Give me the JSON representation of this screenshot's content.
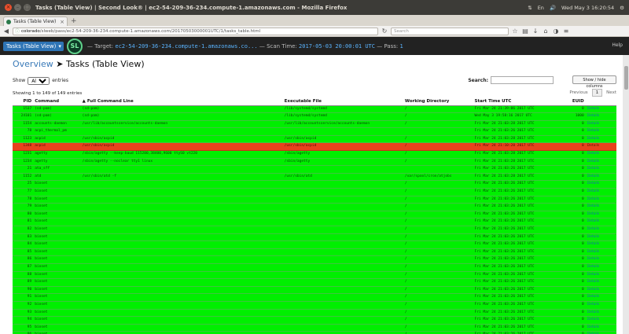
{
  "window": {
    "title": "Tasks (Table View) | Second Look® | ec2-54-209-36-234.compute-1.amazonaws.com - Mozilla Firefox",
    "tray": [
      "⇅",
      "En",
      "🔊",
      "Wed May 3 16:20:54",
      "⚙"
    ]
  },
  "browser": {
    "tab_label": "Tasks (Table View)",
    "url_host": "colorado",
    "url_rest": "/slweb/pass/ec2-54-209-36-234.compute-1.amazonaws.com/20170503000001UTC/1/tasks_table.html",
    "search_placeholder": "Search"
  },
  "header": {
    "dropdown_label": "Tasks (Table View)",
    "logo_text": "SL",
    "target_label": "— Target:",
    "target_value": "ec2-54-209-36-234.compute-1.amazonaws.co...",
    "scan_label": "— Scan Time:",
    "scan_value": "2017-05-03 20:00:01 UTC",
    "pass_label": "— Pass:",
    "pass_value": "1",
    "help": "Help"
  },
  "breadcrumb": {
    "overview": "Overview",
    "sep": "➤",
    "page": "Tasks (Table View)"
  },
  "controls": {
    "show_label": "Show",
    "show_value": "All",
    "entries_label": "entries",
    "search_label": "Search:",
    "show_hide": "Show / hide columns"
  },
  "info": {
    "text": "Showing 1 to 149 of 149 entries",
    "previous": "Previous",
    "page": "1",
    "next": "Next"
  },
  "columns": [
    "PID",
    "Command",
    "Full Command Line",
    "Executable File",
    "Working Directory",
    "Start Time UTC",
    "EUID",
    ""
  ],
  "rows": [
    {
      "status": "ok",
      "pid": "1537",
      "cmd": "(sd-pam)",
      "full": "(sd-pam)",
      "exe": "/lib/systemd/systemd",
      "wd": "/",
      "start": "Fri Mar 24 21:39:06 2017 UTC",
      "euid": "0",
      "det": "Details"
    },
    {
      "status": "ok",
      "pid": "24101",
      "cmd": "(sd-pam)",
      "full": "(sd-pam)",
      "exe": "/lib/systemd/systemd",
      "wd": "/",
      "start": "Wed May 3 19:58:16 2017 UTC",
      "euid": "1000",
      "det": "Details"
    },
    {
      "status": "ok",
      "pid": "1154",
      "cmd": "accounts-daemon",
      "full": "/usr/lib/accountsservice/accounts-daemon",
      "exe": "/usr/lib/accountsservice/accounts-daemon",
      "wd": "/",
      "start": "Fri Mar 24 21:03:28 2017 UTC",
      "euid": "0",
      "det": "Details"
    },
    {
      "status": "ok",
      "pid": "78",
      "cmd": "acpi_thermal_pm",
      "full": "",
      "exe": "",
      "wd": "",
      "start": "Fri Mar 24 21:03:26 2017 UTC",
      "euid": "0",
      "det": "Details"
    },
    {
      "status": "ok",
      "pid": "1123",
      "cmd": "acpid",
      "full": "/usr/sbin/acpid",
      "exe": "/usr/sbin/acpid",
      "wd": "/",
      "start": "Fri Mar 24 21:03:28 2017 UTC",
      "euid": "0",
      "det": "Details"
    },
    {
      "status": "bad",
      "pid": "1348",
      "cmd": "acpid",
      "full": "/usr/sbin/acpid",
      "exe": "/usr/sbin/acpid",
      "wd": "/",
      "start": "Fri Mar 24 21:10:20 2017 UTC",
      "euid": "0",
      "det": "Details"
    },
    {
      "status": "ok",
      "pid": "1231",
      "cmd": "agetty",
      "full": "/sbin/agetty --keep-baud 115200,38400,9600 ttyS0 vt220",
      "exe": "/sbin/agetty",
      "wd": "/",
      "start": "Fri Mar 24 21:03:28 2017 UTC",
      "euid": "0",
      "det": "Details"
    },
    {
      "status": "ok",
      "pid": "1234",
      "cmd": "agetty",
      "full": "/sbin/agetty --noclear tty1 linux",
      "exe": "/sbin/agetty",
      "wd": "/",
      "start": "Fri Mar 24 21:03:28 2017 UTC",
      "euid": "0",
      "det": "Details"
    },
    {
      "status": "ok",
      "pid": "21",
      "cmd": "ata_sff",
      "full": "",
      "exe": "",
      "wd": "",
      "start": "Fri Mar 24 21:03:26 2017 UTC",
      "euid": "0",
      "det": "Details"
    },
    {
      "status": "ok",
      "pid": "1152",
      "cmd": "atd",
      "full": "/usr/sbin/atd -f",
      "exe": "/usr/sbin/atd",
      "wd": "/var/spool/cron/atjobs",
      "start": "Fri Mar 24 21:03:28 2017 UTC",
      "euid": "0",
      "det": "Details"
    },
    {
      "status": "ok",
      "pid": "25",
      "cmd": "bioset",
      "full": "",
      "exe": "",
      "wd": "/",
      "start": "Fri Mar 24 21:03:26 2017 UTC",
      "euid": "0",
      "det": "Details"
    },
    {
      "status": "ok",
      "pid": "77",
      "cmd": "bioset",
      "full": "",
      "exe": "",
      "wd": "/",
      "start": "Fri Mar 24 21:03:26 2017 UTC",
      "euid": "0",
      "det": "Details"
    },
    {
      "status": "ok",
      "pid": "78",
      "cmd": "bioset",
      "full": "",
      "exe": "",
      "wd": "/",
      "start": "Fri Mar 24 21:03:26 2017 UTC",
      "euid": "0",
      "det": "Details"
    },
    {
      "status": "ok",
      "pid": "79",
      "cmd": "bioset",
      "full": "",
      "exe": "",
      "wd": "/",
      "start": "Fri Mar 24 21:03:26 2017 UTC",
      "euid": "0",
      "det": "Details"
    },
    {
      "status": "ok",
      "pid": "80",
      "cmd": "bioset",
      "full": "",
      "exe": "",
      "wd": "/",
      "start": "Fri Mar 24 21:03:26 2017 UTC",
      "euid": "0",
      "det": "Details"
    },
    {
      "status": "ok",
      "pid": "81",
      "cmd": "bioset",
      "full": "",
      "exe": "",
      "wd": "/",
      "start": "Fri Mar 24 21:03:26 2017 UTC",
      "euid": "0",
      "det": "Details"
    },
    {
      "status": "ok",
      "pid": "82",
      "cmd": "bioset",
      "full": "",
      "exe": "",
      "wd": "/",
      "start": "Fri Mar 24 21:03:26 2017 UTC",
      "euid": "0",
      "det": "Details"
    },
    {
      "status": "ok",
      "pid": "83",
      "cmd": "bioset",
      "full": "",
      "exe": "",
      "wd": "/",
      "start": "Fri Mar 24 21:03:26 2017 UTC",
      "euid": "0",
      "det": "Details"
    },
    {
      "status": "ok",
      "pid": "84",
      "cmd": "bioset",
      "full": "",
      "exe": "",
      "wd": "/",
      "start": "Fri Mar 24 21:03:26 2017 UTC",
      "euid": "0",
      "det": "Details"
    },
    {
      "status": "ok",
      "pid": "85",
      "cmd": "bioset",
      "full": "",
      "exe": "",
      "wd": "/",
      "start": "Fri Mar 24 21:03:26 2017 UTC",
      "euid": "0",
      "det": "Details"
    },
    {
      "status": "ok",
      "pid": "86",
      "cmd": "bioset",
      "full": "",
      "exe": "",
      "wd": "/",
      "start": "Fri Mar 24 21:03:26 2017 UTC",
      "euid": "0",
      "det": "Details"
    },
    {
      "status": "ok",
      "pid": "87",
      "cmd": "bioset",
      "full": "",
      "exe": "",
      "wd": "/",
      "start": "Fri Mar 24 21:03:26 2017 UTC",
      "euid": "0",
      "det": "Details"
    },
    {
      "status": "ok",
      "pid": "88",
      "cmd": "bioset",
      "full": "",
      "exe": "",
      "wd": "/",
      "start": "Fri Mar 24 21:03:26 2017 UTC",
      "euid": "0",
      "det": "Details"
    },
    {
      "status": "ok",
      "pid": "89",
      "cmd": "bioset",
      "full": "",
      "exe": "",
      "wd": "/",
      "start": "Fri Mar 24 21:03:26 2017 UTC",
      "euid": "0",
      "det": "Details"
    },
    {
      "status": "ok",
      "pid": "90",
      "cmd": "bioset",
      "full": "",
      "exe": "",
      "wd": "/",
      "start": "Fri Mar 24 21:03:26 2017 UTC",
      "euid": "0",
      "det": "Details"
    },
    {
      "status": "ok",
      "pid": "91",
      "cmd": "bioset",
      "full": "",
      "exe": "",
      "wd": "/",
      "start": "Fri Mar 24 21:03:26 2017 UTC",
      "euid": "0",
      "det": "Details"
    },
    {
      "status": "ok",
      "pid": "92",
      "cmd": "bioset",
      "full": "",
      "exe": "",
      "wd": "/",
      "start": "Fri Mar 24 21:03:26 2017 UTC",
      "euid": "0",
      "det": "Details"
    },
    {
      "status": "ok",
      "pid": "93",
      "cmd": "bioset",
      "full": "",
      "exe": "",
      "wd": "/",
      "start": "Fri Mar 24 21:03:26 2017 UTC",
      "euid": "0",
      "det": "Details"
    },
    {
      "status": "ok",
      "pid": "94",
      "cmd": "bioset",
      "full": "",
      "exe": "",
      "wd": "/",
      "start": "Fri Mar 24 21:03:26 2017 UTC",
      "euid": "0",
      "det": "Details"
    },
    {
      "status": "ok",
      "pid": "95",
      "cmd": "bioset",
      "full": "",
      "exe": "",
      "wd": "/",
      "start": "Fri Mar 24 21:03:26 2017 UTC",
      "euid": "0",
      "det": "Details"
    },
    {
      "status": "ok",
      "pid": "96",
      "cmd": "bioset",
      "full": "",
      "exe": "",
      "wd": "/",
      "start": "Fri Mar 24 21:03:26 2017 UTC",
      "euid": "0",
      "det": "Details"
    }
  ]
}
